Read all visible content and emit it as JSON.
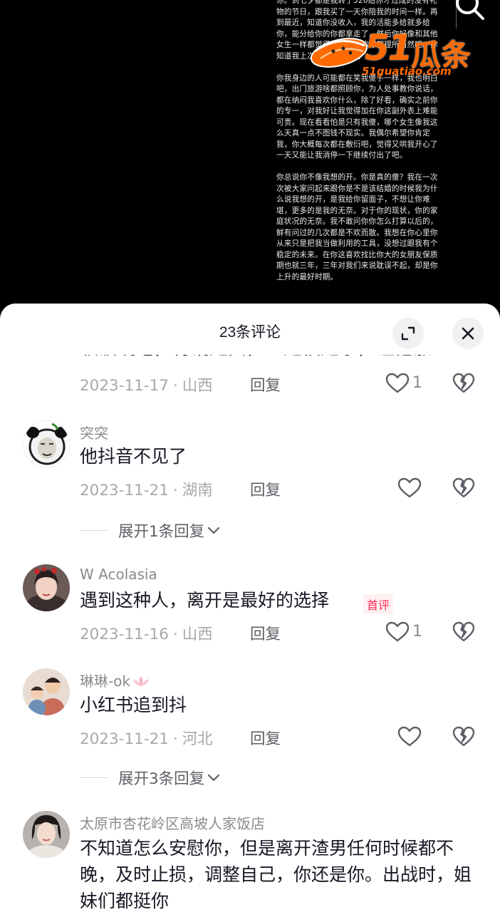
{
  "post": {
    "paragraphs": [
      "你。到七夕都是我转了520给你才过成的没有礼物的节日，跟我买了一天你陪我的时间一样。再到最近，知道你没收入，我的活能多给就多给你，能分给你的你都拿走了，然后你好像和其他女生一样都觉得我对你们的好都理所当然吧。你知道我上次心里多难受吗",
      "你我身边的人可能都在笑我傻子一样，我也明白吧，出门旅游啥都照顾你，为人处事教你说话，都在纳闷我喜欢你什么，除了好看，确实之前你的专一，对我好让我觉得加在你这副外表上难能可贵。现在看看怕是只有我傻，哪个女生像我这么天真一点不图钱不现实。我偶尔希望你肯定我，你大概每次都在敷衍吧，觉得又哄我开心了一天又能让我消停一下继续付出了吧。",
      "你总说你不像我想的开。你是真的傻？我在一次次被大家问起来跟你是不是该结婚的时候我为什么说我想的开，是我给你留面子，不想让你难堪，更多的是我的无奈。对于你的现状，你的家庭状况的无奈。我不敢问你你怎么打算以后的，鲜有问过的几次都是不欢而散。我想在你心里你从来只是把我当做利用的工具，没想过跟我有个稳定的未来。在你这喜欢找比你大的女朋友保质期也就三年，三年对我们来说耽误不起，却是你上升的最好时期。"
    ]
  },
  "watermark": {
    "number": "51",
    "name": "瓜条",
    "url": "51guatiao.com"
  },
  "sheet": {
    "title": "23条评论"
  },
  "cut_comment": {
    "text": "软饭硬吃，背锅是女，坐是福是家，让他涨",
    "date": "2023-11-17",
    "region": "山西",
    "reply": "回复",
    "likes": "1"
  },
  "comments": [
    {
      "name": "突突",
      "text": "他抖音不见了",
      "date": "2023-11-21",
      "region": "湖南",
      "reply": "回复",
      "likes": "",
      "expand": "展开1条回复"
    },
    {
      "name": "W Acolasia",
      "text": "遇到这种人，离开是最好的选择",
      "badge": "首评",
      "date": "2023-11-16",
      "region": "山西",
      "reply": "回复",
      "likes": "1"
    },
    {
      "name": "琳琳-ok",
      "text": "小红书追到抖",
      "date": "2023-11-21",
      "region": "河北",
      "reply": "回复",
      "likes": "",
      "expand": "展开3条回复"
    },
    {
      "name": "太原市杏花岭区高坡人家饭店",
      "text": "不知道怎么安慰你，但是离开渣男任何时候都不晚，及时止损，调整自己，你还是你。出战时，姐妹们都挺你"
    }
  ],
  "colors": {
    "accent": "#fe2c55",
    "watermark": "#ff6a00",
    "text": "#161823",
    "muted": "#a7a8ad"
  }
}
